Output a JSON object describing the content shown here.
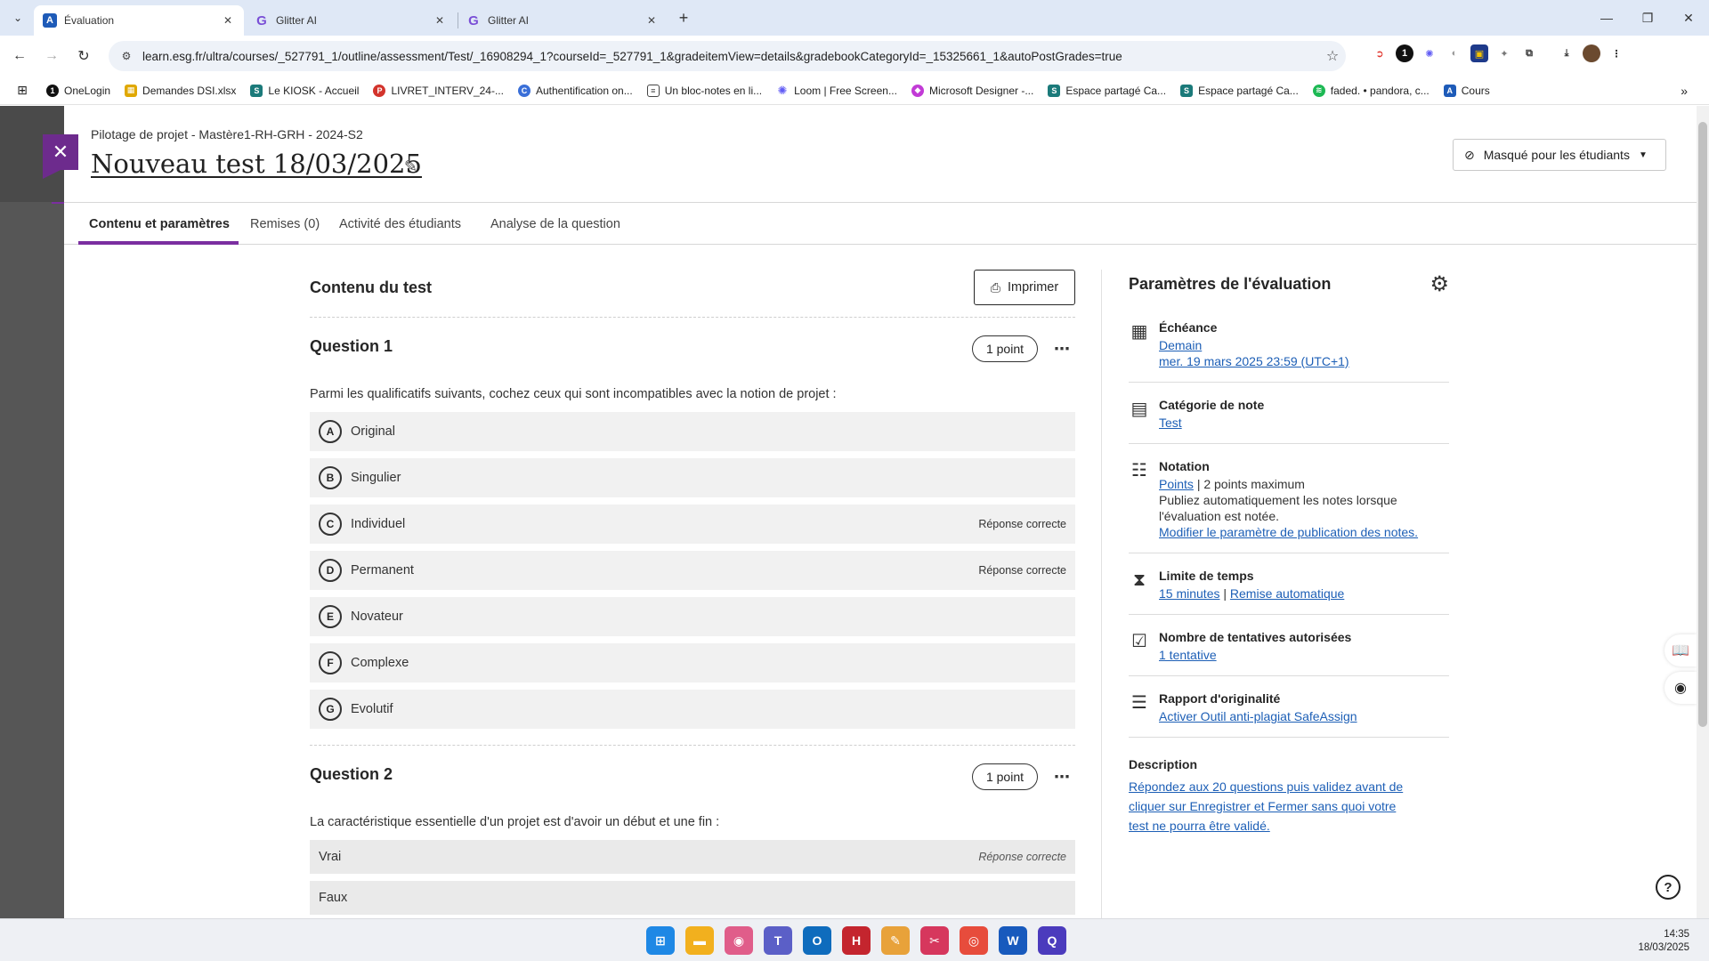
{
  "browser": {
    "tabs": [
      {
        "title": "Évaluation",
        "favicon": "blackboard-icon"
      },
      {
        "title": "Glitter AI",
        "favicon": "glitter-icon"
      },
      {
        "title": "Glitter AI",
        "favicon": "glitter-icon"
      }
    ],
    "url": "learn.esg.fr/ultra/courses/_527791_1/outline/assessment/Test/_16908294_1?courseId=_527791_1&gradeitemView=details&gradebookCategoryId=_15325661_1&autoPostGrades=true",
    "bookmarks": [
      {
        "label": "OneLogin",
        "color": "#111111"
      },
      {
        "label": "Demandes DSI.xlsx",
        "color": "#e0a800"
      },
      {
        "label": "Le KIOSK - Accueil",
        "color": "#1b7a7a"
      },
      {
        "label": "LIVRET_INTERV_24-...",
        "color": "#d3342c"
      },
      {
        "label": "Authentification on...",
        "color": "#3a6fd8"
      },
      {
        "label": "Un bloc-notes en li...",
        "color": "#444444"
      },
      {
        "label": "Loom | Free Screen...",
        "color": "#625df5"
      },
      {
        "label": "Microsoft Designer -...",
        "color": "#c23bd6"
      },
      {
        "label": "Espace partagé Ca...",
        "color": "#1b7a7a"
      },
      {
        "label": "Espace partagé Ca...",
        "color": "#1b7a7a"
      },
      {
        "label": "faded. • pandora, c...",
        "color": "#1db954"
      },
      {
        "label": "Cours",
        "color": "#1e5bb8"
      }
    ]
  },
  "header": {
    "breadcrumb": "Pilotage de projet - Mastère1-RH-GRH - 2024-S2",
    "title": "Nouveau test 18/03/2025",
    "visibility": "Masqué pour les étudiants"
  },
  "tabs": [
    "Contenu et paramètres",
    "Remises (0)",
    "Activité des étudiants",
    "Analyse de la question"
  ],
  "content": {
    "title": "Contenu du test",
    "print_label": "Imprimer",
    "questions": [
      {
        "title": "Question 1",
        "points": "1 point",
        "text": "Parmi les qualificatifs suivants, cochez ceux qui sont incompatibles avec la notion de projet :",
        "answers": [
          {
            "letter": "A",
            "text": "Original",
            "correct": ""
          },
          {
            "letter": "B",
            "text": "Singulier",
            "correct": ""
          },
          {
            "letter": "C",
            "text": "Individuel",
            "correct": "Réponse correcte"
          },
          {
            "letter": "D",
            "text": "Permanent",
            "correct": "Réponse correcte"
          },
          {
            "letter": "E",
            "text": "Novateur",
            "correct": ""
          },
          {
            "letter": "F",
            "text": "Complexe",
            "correct": ""
          },
          {
            "letter": "G",
            "text": "Evolutif",
            "correct": ""
          }
        ]
      },
      {
        "title": "Question 2",
        "points": "1 point",
        "text": "La caractéristique essentielle d'un projet est d'avoir un début et une fin :",
        "answers": [
          {
            "text": "Vrai",
            "correct": "Réponse correcte"
          },
          {
            "text": "Faux",
            "correct": ""
          }
        ]
      }
    ]
  },
  "settings": {
    "title": "Paramètres de l'évaluation",
    "due": {
      "name": "Échéance",
      "line1": "Demain",
      "line2": "mer. 19 mars 2025 23:59 (UTC+1)"
    },
    "category": {
      "name": "Catégorie de note",
      "value": "Test"
    },
    "grading": {
      "name": "Notation",
      "link": "Points",
      "max": "| 2 points maximum",
      "text": "Publiez automatiquement les notes lorsque l'évaluation est notée.",
      "link2": "Modifier le paramètre de publication des notes."
    },
    "time": {
      "name": "Limite de temps",
      "value": "15 minutes",
      "sep": "|",
      "value2": "Remise automatique"
    },
    "attempts": {
      "name": "Nombre de tentatives autorisées",
      "value": "1 tentative"
    },
    "originality": {
      "name": "Rapport d'originalité",
      "value": "Activer Outil anti-plagiat SafeAssign"
    },
    "description": {
      "name": "Description",
      "text": "Répondez aux 20 questions puis validez avant de cliquer sur Enregistrer et Fermer sans quoi votre test ne pourra être validé."
    }
  },
  "taskbar": {
    "time": "14:35",
    "date": "18/03/2025",
    "apps": [
      {
        "name": "windows-start-icon",
        "color": "#1e88e5",
        "glyph": "⊞"
      },
      {
        "name": "file-explorer-icon",
        "color": "#f2b01e",
        "glyph": "▬"
      },
      {
        "name": "photos-icon",
        "color": "#e05d8a",
        "glyph": "◉"
      },
      {
        "name": "teams-icon",
        "color": "#5b5fc7",
        "glyph": "T"
      },
      {
        "name": "outlook-icon",
        "color": "#0f6cbd",
        "glyph": "O"
      },
      {
        "name": "h-app-icon",
        "color": "#c4252e",
        "glyph": "H"
      },
      {
        "name": "pencil-app-icon",
        "color": "#e8a23a",
        "glyph": "✎"
      },
      {
        "name": "snipping-tool-icon",
        "color": "#d6375d",
        "glyph": "✂"
      },
      {
        "name": "chrome-icon",
        "color": "#e74c3c",
        "glyph": "◎"
      },
      {
        "name": "word-icon",
        "color": "#185abd",
        "glyph": "W"
      },
      {
        "name": "quickassist-icon",
        "color": "#4b3bbd",
        "glyph": "Q"
      }
    ]
  }
}
